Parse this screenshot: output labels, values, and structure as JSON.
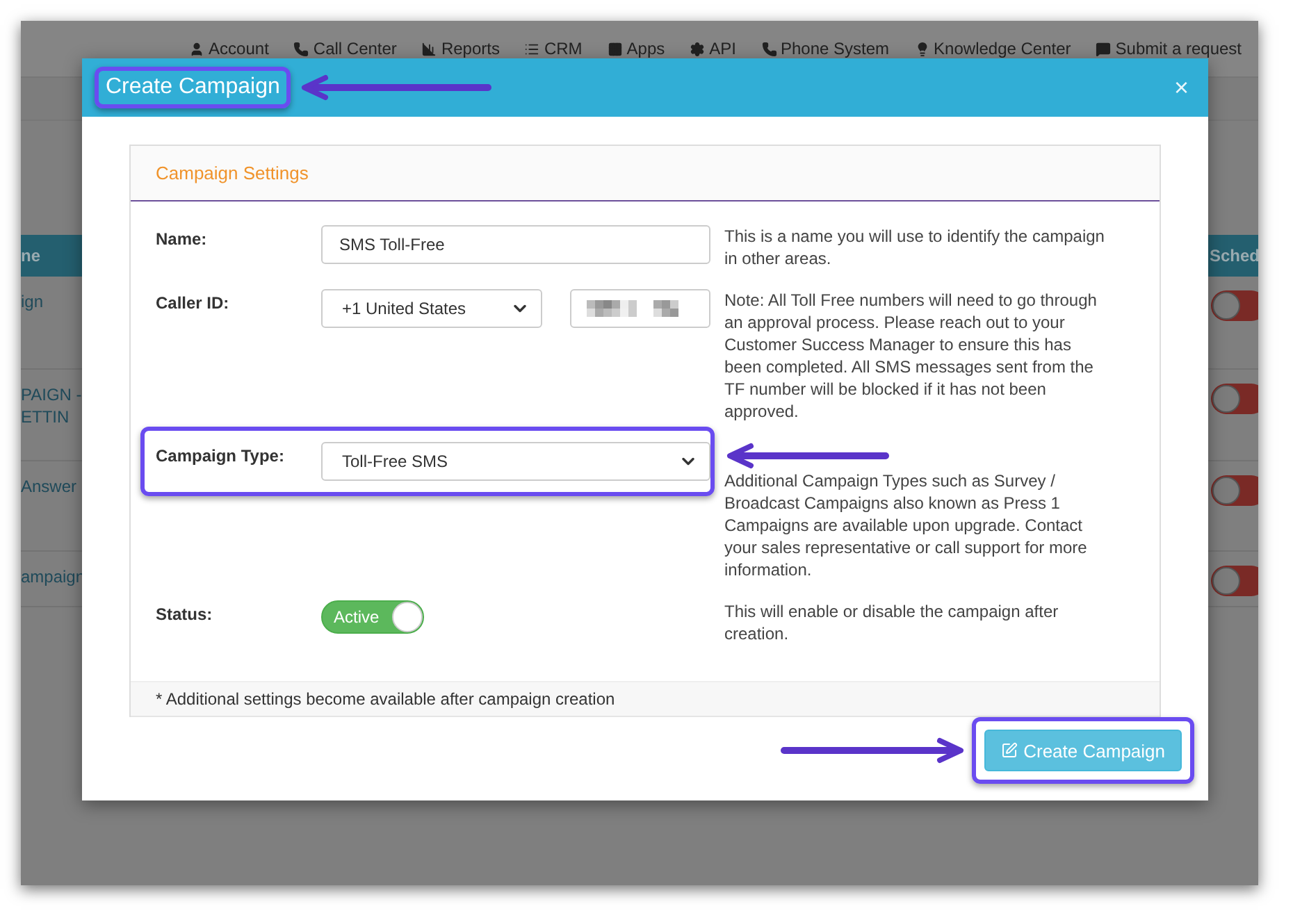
{
  "nav": [
    {
      "label": "Account"
    },
    {
      "label": "Call Center"
    },
    {
      "label": "Reports"
    },
    {
      "label": "CRM"
    },
    {
      "label": "Apps"
    },
    {
      "label": "API"
    },
    {
      "label": "Phone System"
    },
    {
      "label": "Knowledge Center"
    },
    {
      "label": "Submit a request"
    }
  ],
  "background_table": {
    "left_header": "ne",
    "right_header": "Sched",
    "rows": [
      {
        "left_lines": [
          "ign"
        ],
        "schedule_on": false
      },
      {
        "left_lines": [
          "PAIGN -",
          "ETTIN"
        ],
        "schedule_on": false
      },
      {
        "left_lines": [
          "Answer"
        ],
        "schedule_on": false
      },
      {
        "left_lines": [
          "ampaign"
        ],
        "schedule_on": false
      }
    ]
  },
  "modal": {
    "title": "Create Campaign",
    "title_highlighted": true,
    "close": "×",
    "panel": {
      "heading": "Campaign Settings",
      "fields": [
        {
          "kind": "text",
          "label": "Name:",
          "value": "SMS Toll-Free",
          "highlighted": false,
          "help": "This is a name you will use to identify the campaign in other areas."
        },
        {
          "kind": "caller_id",
          "label": "Caller ID:",
          "value": "+1 United States",
          "highlighted": false,
          "help": "Note: All Toll Free numbers will need to go through an approval process. Please reach out to your Customer Success Manager to ensure this has been completed. All SMS messages sent from the TF number will be blocked if it has not been approved."
        },
        {
          "kind": "select",
          "label": "Campaign Type:",
          "value": "Toll-Free SMS",
          "highlighted": true,
          "help": "Additional Campaign Types such as Survey / Broadcast Campaigns also known as Press 1 Campaigns are available upon upgrade. Contact your sales representative or call support for more information."
        },
        {
          "kind": "toggle",
          "label": "Status:",
          "value": "Active",
          "on": true,
          "highlighted": false,
          "help": "This will enable or disable the campaign after creation."
        }
      ],
      "note": "* Additional settings become available after campaign creation"
    },
    "submit": {
      "label": "Create Campaign",
      "highlighted": true
    }
  }
}
